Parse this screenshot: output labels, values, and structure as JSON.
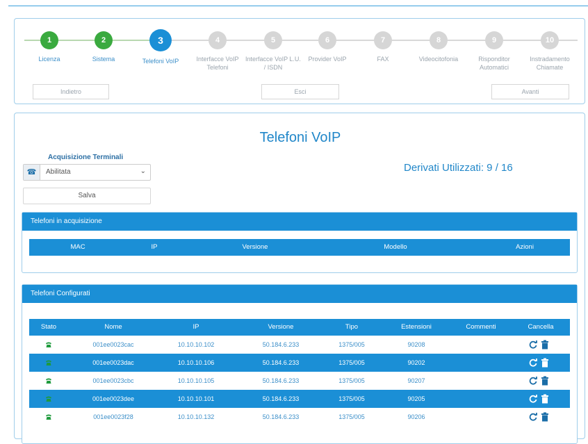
{
  "wizard": {
    "steps": [
      {
        "num": "1",
        "label": "Licenza"
      },
      {
        "num": "2",
        "label": "Sistema"
      },
      {
        "num": "3",
        "label": "Telefoni VoIP"
      },
      {
        "num": "4",
        "label": "Interfacce VoIP Telefoni"
      },
      {
        "num": "5",
        "label": "Interfacce VoIP L.U. / ISDN"
      },
      {
        "num": "6",
        "label": "Provider VoIP"
      },
      {
        "num": "7",
        "label": "FAX"
      },
      {
        "num": "8",
        "label": "Videocitofonia"
      },
      {
        "num": "9",
        "label": "Risponditor Automatici"
      },
      {
        "num": "10",
        "label": "Instradamento Chiamate"
      }
    ],
    "back_label": "Indietro",
    "exit_label": "Esci",
    "next_label": "Avanti"
  },
  "main": {
    "title": "Telefoni VoIP",
    "acq_label": "Acquisizione Terminali",
    "acq_value": "Abilitata",
    "save_label": "Salva",
    "derivati": "Derivati Utilizzati: 9 / 16"
  },
  "acquisition": {
    "title": "Telefoni in acquisizione",
    "columns": [
      "MAC",
      "IP",
      "Versione",
      "Modello",
      "Azioni"
    ]
  },
  "configured": {
    "title": "Telefoni Configurati",
    "columns": [
      "Stato",
      "Nome",
      "IP",
      "Versione",
      "Tipo",
      "Estensioni",
      "Commenti",
      "Cancella"
    ],
    "rows": [
      {
        "nome": "001ee0023cac",
        "ip": "10.10.10.102",
        "versione": "50.184.6.233",
        "tipo": "1375/005",
        "estensioni": "90208",
        "commenti": ""
      },
      {
        "nome": "001ee0023dac",
        "ip": "10.10.10.106",
        "versione": "50.184.6.233",
        "tipo": "1375/005",
        "estensioni": "90202",
        "commenti": ""
      },
      {
        "nome": "001ee0023cbc",
        "ip": "10.10.10.105",
        "versione": "50.184.6.233",
        "tipo": "1375/005",
        "estensioni": "90207",
        "commenti": ""
      },
      {
        "nome": "001ee0023dee",
        "ip": "10.10.10.101",
        "versione": "50.184.6.233",
        "tipo": "1375/005",
        "estensioni": "90205",
        "commenti": ""
      },
      {
        "nome": "001ee0023f28",
        "ip": "10.10.10.132",
        "versione": "50.184.6.233",
        "tipo": "1375/005",
        "estensioni": "90206",
        "commenti": ""
      }
    ]
  },
  "colors": {
    "accent": "#1b8fd6",
    "done": "#3aaa3f",
    "pending": "#d6d6d6",
    "status_online": "#1e9a3c"
  },
  "icons": {
    "phone": "phone-icon",
    "refresh": "refresh-icon",
    "trash": "trash-icon"
  }
}
